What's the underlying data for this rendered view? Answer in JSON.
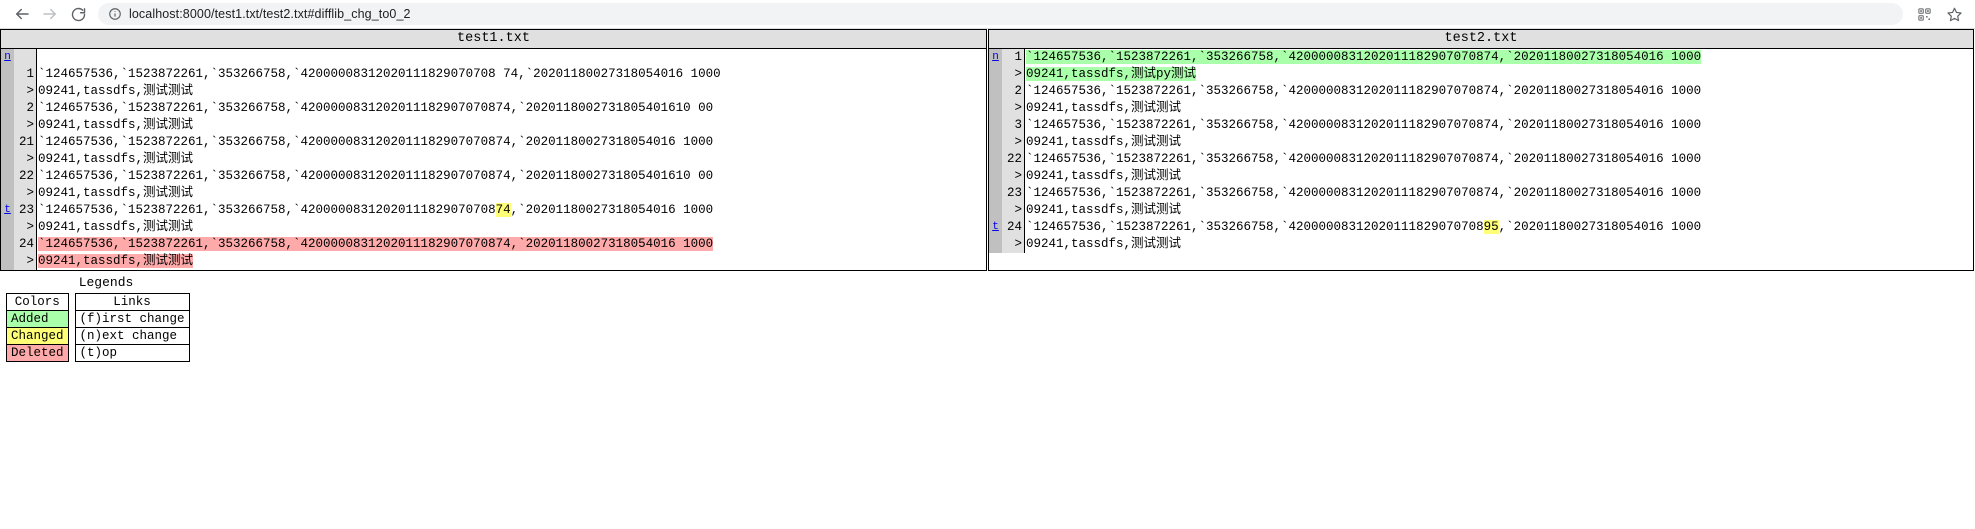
{
  "browser": {
    "back_icon": "arrow-left-icon",
    "forward_icon": "arrow-right-icon",
    "reload_icon": "reload-icon",
    "site_info_icon": "info-circle-icon",
    "url": "localhost:8000/test1.txt/test2.txt#difflib_chg_to0_2",
    "qr_icon": "qr-code-icon",
    "bookmark_icon": "star-icon"
  },
  "diff": {
    "left_title": "test1.txt",
    "right_title": "test2.txt",
    "long_line": "`124657536,`1523872261,`353266758,`420000083120201118290707087",
    "cont_marker": ">",
    "left": [
      {
        "link": "n",
        "link_href": "#difflib_chg_to0_0",
        "num": "",
        "text": "",
        "style": "none",
        "wrap": false
      },
      {
        "link": "",
        "num": "1",
        "text": "`124657536,`1523872261,`353266758,`42000008312020111829070708 74,`20201180027318054016 1000",
        "style": "none",
        "wrap": false
      },
      {
        "link": "",
        "num": ">",
        "text": "09241,tassdfs,测试测试",
        "style": "none",
        "wrap": true
      },
      {
        "link": "",
        "num": "2",
        "text": "`124657536,`1523872261,`353266758,`4200000831202011182907070874,`2020118002731805401610 00",
        "style": "none",
        "wrap": false
      },
      {
        "link": "",
        "num": ">",
        "text": "09241,tassdfs,测试测试",
        "style": "none",
        "wrap": true
      },
      {
        "link": "",
        "num": "21",
        "text": "`124657536,`1523872261,`353266758,`4200000831202011182907070874,`20201180027318054016 1000",
        "style": "none",
        "wrap": false
      },
      {
        "link": "",
        "num": ">",
        "text": "09241,tassdfs,测试测试",
        "style": "none",
        "wrap": true
      },
      {
        "link": "",
        "num": "22",
        "text": "`124657536,`1523872261,`353266758,`4200000831202011182907070874,`2020118002731805401610 00",
        "style": "none",
        "wrap": false
      },
      {
        "link": "",
        "num": ">",
        "text": "09241,tassdfs,测试测试",
        "style": "none",
        "wrap": true
      },
      {
        "link": "t",
        "link_href": "#difflib_chg_to0_top",
        "num": "23",
        "text": "",
        "style": "changed",
        "wrap": false
      },
      {
        "link": "",
        "num": ">",
        "text": "09241,tassdfs,测试测试",
        "style": "none",
        "wrap": true
      },
      {
        "link": "",
        "num": "24",
        "text": "`124657536,`1523872261,`353266758,`4200000831202011182907070874,`20201180027318054016 1000",
        "style": "deleted",
        "wrap": false
      },
      {
        "link": "",
        "num": ">",
        "text": "09241,tassdfs,测试测试",
        "style": "deleted",
        "wrap": true
      }
    ],
    "right": [
      {
        "link": "n",
        "link_href": "#difflib_chg_to0_2",
        "num": "1",
        "text": "`124657536,`1523872261,`353266758,`4200000831202011182907070874,`20201180027318054016 1000",
        "style": "added",
        "wrap": false
      },
      {
        "link": "",
        "num": ">",
        "text": "09241,tassdfs,测试py测试",
        "style": "added",
        "wrap": true
      },
      {
        "link": "",
        "num": "2",
        "text": "`124657536,`1523872261,`353266758,`4200000831202011182907070874,`20201180027318054016 1000",
        "style": "none",
        "wrap": false
      },
      {
        "link": "",
        "num": ">",
        "text": "09241,tassdfs,测试测试",
        "style": "none",
        "wrap": true
      },
      {
        "link": "",
        "num": "3",
        "text": "`124657536,`1523872261,`353266758,`4200000831202011182907070874,`20201180027318054016 1000",
        "style": "none",
        "wrap": false
      },
      {
        "link": "",
        "num": ">",
        "text": "09241,tassdfs,测试测试",
        "style": "none",
        "wrap": true
      },
      {
        "link": "",
        "num": "22",
        "text": "`124657536,`1523872261,`353266758,`4200000831202011182907070874,`20201180027318054016 1000",
        "style": "none",
        "wrap": false
      },
      {
        "link": "",
        "num": ">",
        "text": "09241,tassdfs,测试测试",
        "style": "none",
        "wrap": true
      },
      {
        "link": "",
        "num": "23",
        "text": "`124657536,`1523872261,`353266758,`4200000831202011182907070874,`20201180027318054016 1000",
        "style": "none",
        "wrap": false
      },
      {
        "link": "",
        "num": ">",
        "text": "09241,tassdfs,测试测试",
        "style": "none",
        "wrap": true
      },
      {
        "link": "t",
        "link_href": "#difflib_chg_to0_top",
        "num": "24",
        "text": "",
        "style": "changed",
        "wrap": false
      },
      {
        "link": "",
        "num": ">",
        "text": "09241,tassdfs,测试测试",
        "style": "none",
        "wrap": true
      }
    ],
    "changed_line": {
      "prefix": "`124657536,`1523872261,`353266758,`42000008312020111829070708",
      "left_token": "74",
      "right_token": "95",
      "suffix": ",`20201180027318054016 1000"
    }
  },
  "legends": {
    "title": "Legends",
    "colors_header": "Colors",
    "links_header": "Links",
    "colors": [
      {
        "label": "Added",
        "swatch": "#aaffaa"
      },
      {
        "label": "Changed",
        "swatch": "#ffff77"
      },
      {
        "label": "Deleted",
        "swatch": "#ffaaaa"
      }
    ],
    "links": [
      {
        "label": "(f)irst change"
      },
      {
        "label": "(n)ext change"
      },
      {
        "label": "(t)op"
      }
    ]
  }
}
